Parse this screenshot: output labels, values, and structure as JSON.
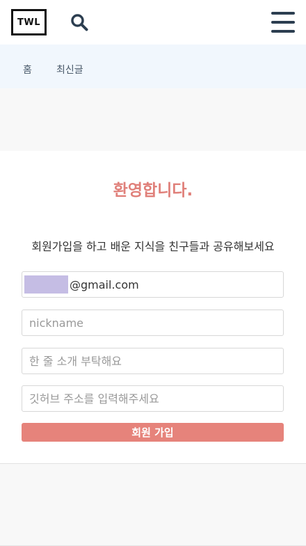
{
  "header": {
    "logo_text": "TWL",
    "search_icon": "search-icon",
    "menu_icon": "hamburger-menu-icon"
  },
  "nav": {
    "items": [
      {
        "label": "홈"
      },
      {
        "label": "최신글"
      }
    ]
  },
  "signup": {
    "title": "환영합니다.",
    "intro": "회원가입을 하고 배운 지식을 친구들과 공유해보세요",
    "email_suffix": "@gmail.com",
    "nickname_placeholder": "nickname",
    "bio_placeholder": "한 줄 소개 부탁해요",
    "github_placeholder": "깃허브 주소를 입력해주세요",
    "submit_label": "회원 가입"
  },
  "colors": {
    "accent": "#e6837b",
    "nav_background": "#f1f7fd",
    "header_icon": "#2c3e50",
    "email_mask": "#c5bde4"
  }
}
